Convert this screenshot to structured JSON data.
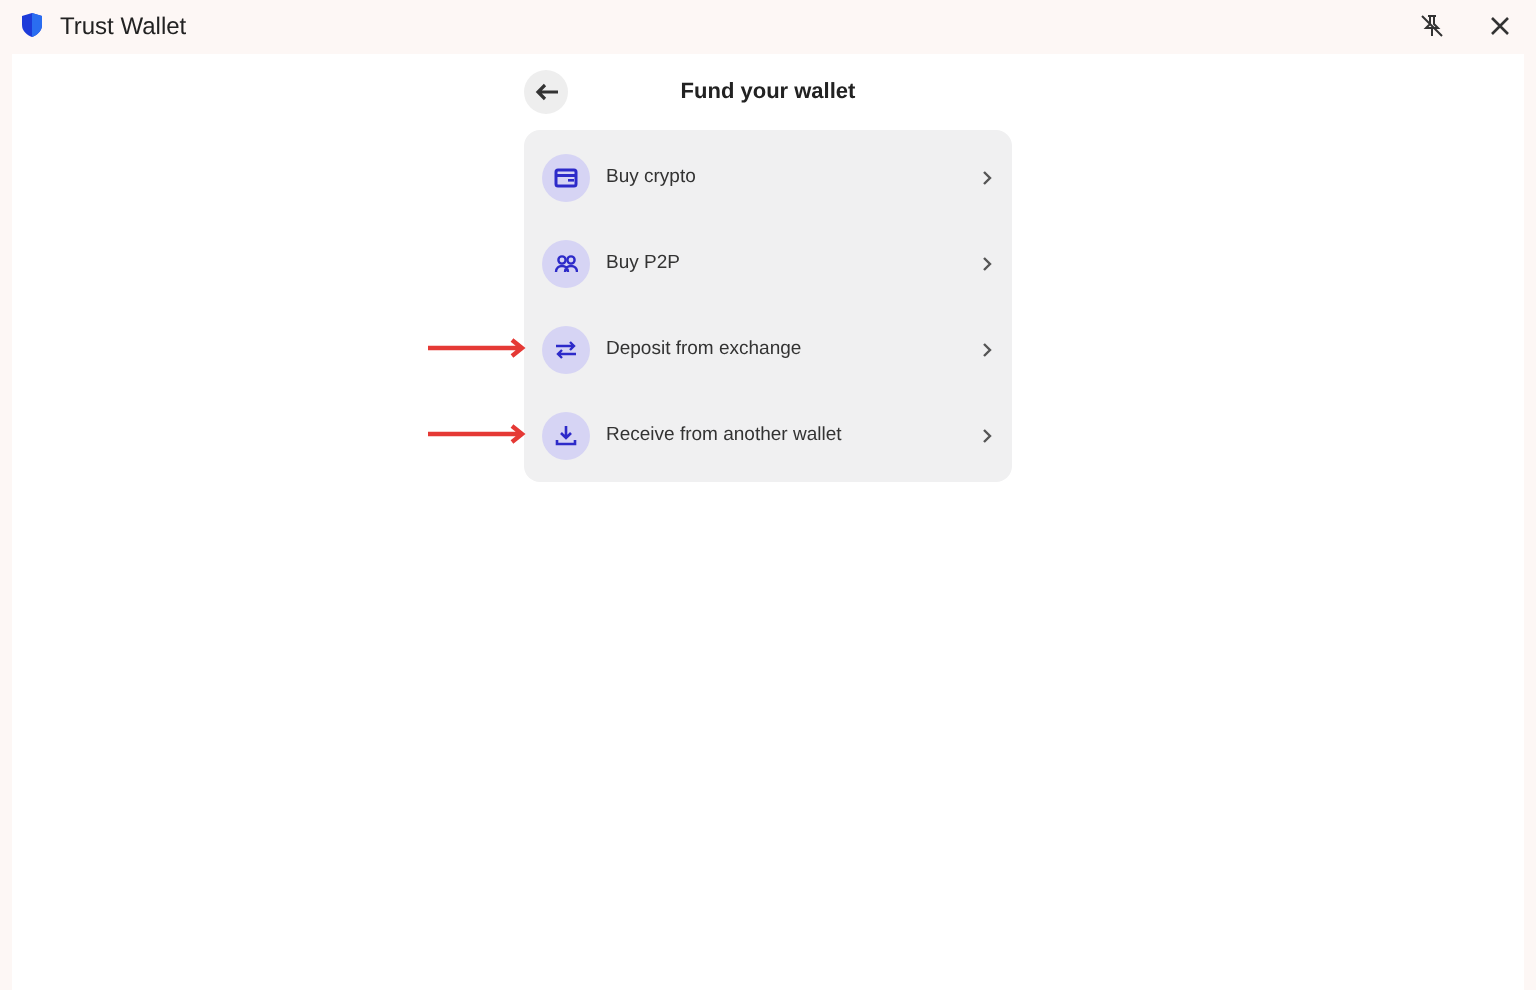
{
  "window": {
    "title": "Trust Wallet"
  },
  "header": {
    "title": "Fund your wallet"
  },
  "options": [
    {
      "kind": "card",
      "label": "Buy crypto",
      "highlighted": false
    },
    {
      "kind": "people",
      "label": "Buy P2P",
      "highlighted": false
    },
    {
      "kind": "swap",
      "label": "Deposit from exchange",
      "highlighted": true
    },
    {
      "kind": "download",
      "label": "Receive from another wallet",
      "highlighted": true
    }
  ]
}
